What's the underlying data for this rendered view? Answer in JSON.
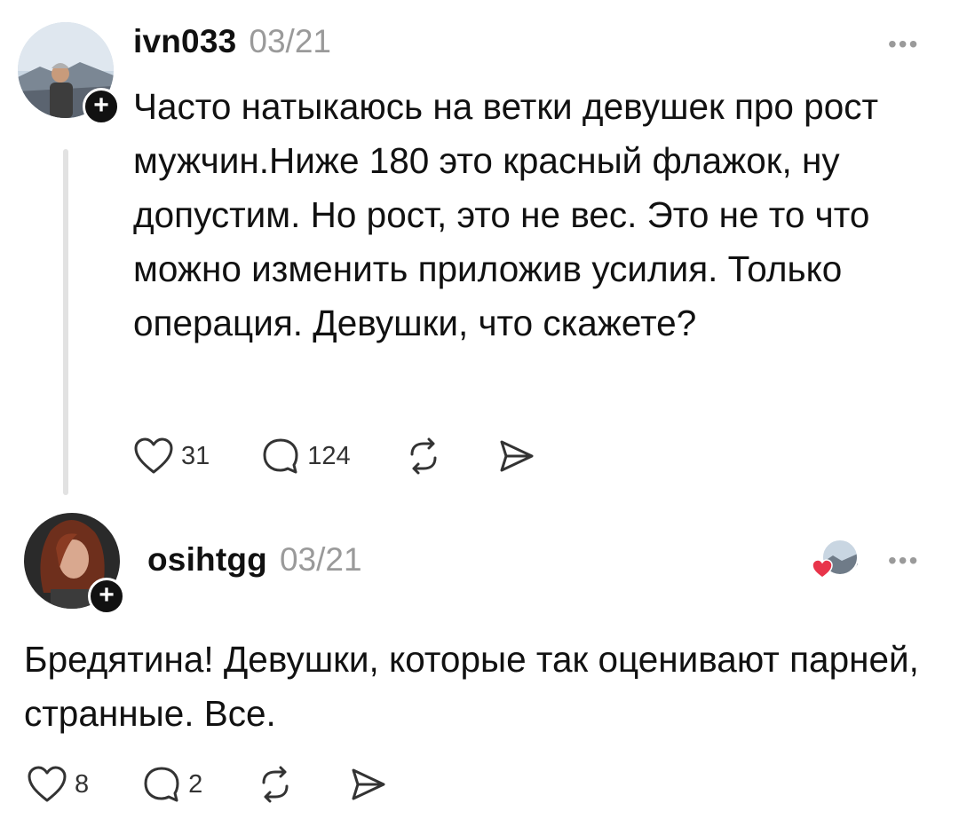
{
  "post": {
    "username": "ivn033",
    "date": "03/21",
    "text": "Часто натыкаюсь на ветки девушек про рост мужчин.Ниже 180 это красный флажок, ну допустим. Но рост, это не вес. Это не то что можно изменить приложив усилия. Только операция. Девушки, что скажете?",
    "likes": "31",
    "comments": "124",
    "more_icon": "more-dots-icon"
  },
  "reply": {
    "username": "osihtgg",
    "date": "03/21",
    "text": "Бредятина! Девушки, которые так оценивают парней, странные. Все.",
    "likes": "8",
    "comments": "2",
    "more_icon": "more-dots-icon"
  },
  "colors": {
    "text": "#111111",
    "muted": "#9a9a9a",
    "thread_line": "#e2e2e2",
    "heart": "#e8344a"
  }
}
